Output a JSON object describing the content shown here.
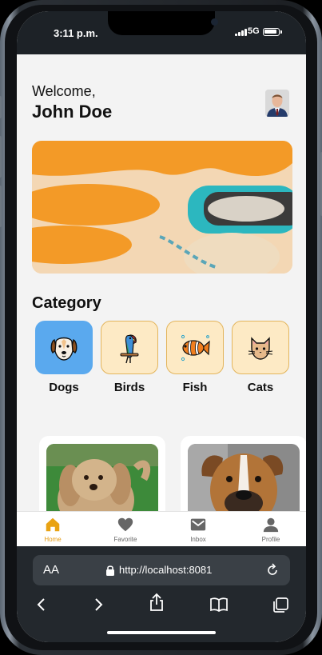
{
  "status_bar": {
    "time": "3:11 p.m.",
    "network": "5G"
  },
  "header": {
    "greeting": "Welcome,",
    "user_name": "John Doe"
  },
  "categories": {
    "title": "Category",
    "items": [
      {
        "label": "Dogs",
        "icon": "dog-icon",
        "selected": true
      },
      {
        "label": "Birds",
        "icon": "parrot-icon",
        "selected": false
      },
      {
        "label": "Fish",
        "icon": "clownfish-icon",
        "selected": false
      },
      {
        "label": "Cats",
        "icon": "cat-icon",
        "selected": false
      }
    ]
  },
  "tabs": [
    {
      "label": "Home",
      "icon": "home-icon",
      "active": true
    },
    {
      "label": "Favorite",
      "icon": "heart-icon",
      "active": false
    },
    {
      "label": "Inbox",
      "icon": "mail-icon",
      "active": false
    },
    {
      "label": "Profile",
      "icon": "person-icon",
      "active": false
    }
  ],
  "browser": {
    "text_size_label": "AA",
    "url": "http://localhost:8081"
  },
  "colors": {
    "accent": "#e49b12",
    "selected_tile": "#5aa9ee",
    "tile": "#fdeac5",
    "tile_border": "#e3b55c"
  }
}
